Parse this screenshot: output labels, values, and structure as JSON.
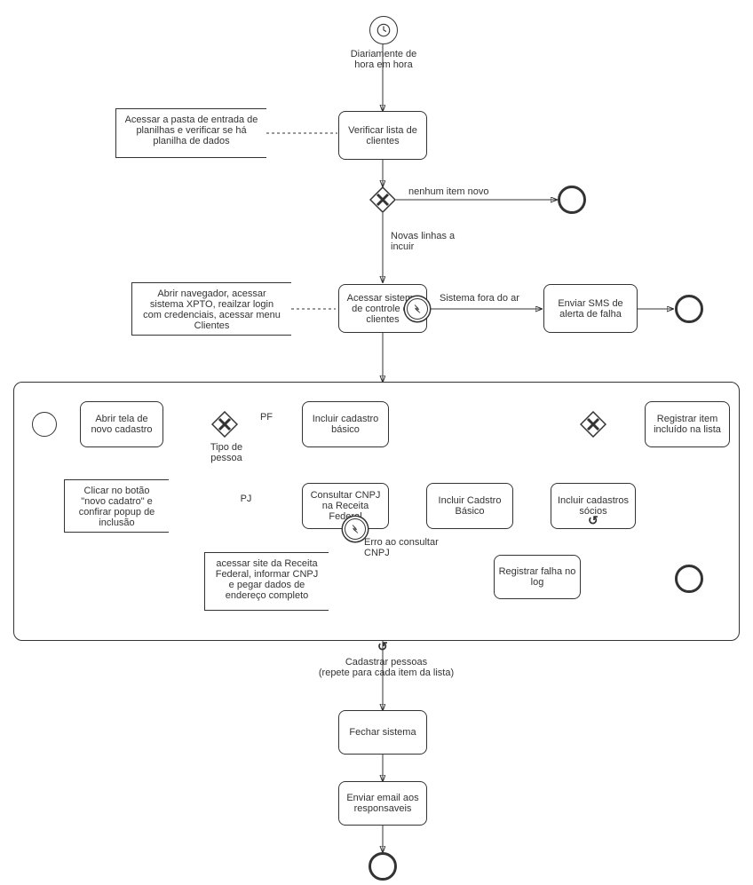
{
  "chart_data": {
    "type": "bpmn-diagram",
    "start_event": {
      "type": "timer",
      "label": "Diariamente de hora em hora"
    },
    "nodes": [
      {
        "id": "verificar",
        "type": "task",
        "label": "Verificar lista de clientes"
      },
      {
        "id": "gw1",
        "type": "exclusive-gateway"
      },
      {
        "id": "acessar",
        "type": "task",
        "label": "Acessar sistema de controle de clientes",
        "boundary": "error"
      },
      {
        "id": "sms",
        "type": "task",
        "label": "Enviar SMS de alerta de falha"
      },
      {
        "id": "subprocess",
        "type": "expanded-subprocess",
        "loop": true,
        "label": "Cadastrar pessoas (repete para cada item da lista)"
      },
      {
        "id": "fechar",
        "type": "task",
        "label": "Fechar sistema"
      },
      {
        "id": "email",
        "type": "task",
        "label": "Enviar email aos responsaveis"
      }
    ],
    "subprocess_nodes": [
      {
        "id": "sp-start",
        "type": "start-event"
      },
      {
        "id": "abrir",
        "type": "task",
        "label": "Abrir tela de novo cadastro"
      },
      {
        "id": "gw-tipo",
        "type": "exclusive-gateway",
        "label": "Tipo de pessoa"
      },
      {
        "id": "incluir-pf",
        "type": "task",
        "label": "Incluir cadastro básico"
      },
      {
        "id": "consultar",
        "type": "task",
        "label": "Consultar CNPJ na Receita Federal",
        "boundary": "error"
      },
      {
        "id": "incluir-pj",
        "type": "task",
        "label": "Incluir Cadstro Básico"
      },
      {
        "id": "socios",
        "type": "task",
        "label": "Incluir cadastros sócios",
        "loop": true
      },
      {
        "id": "gw-merge",
        "type": "exclusive-gateway"
      },
      {
        "id": "registrar",
        "type": "task",
        "label": "Registrar item incluído na lista"
      },
      {
        "id": "falha",
        "type": "task",
        "label": "Registrar falha no log"
      },
      {
        "id": "sp-end",
        "type": "end-event"
      }
    ],
    "edges": [
      {
        "from": "gw1",
        "to": "end1",
        "label": "nenhum item novo"
      },
      {
        "from": "gw1",
        "to": "acessar",
        "label": "Novas linhas a incuir"
      },
      {
        "from": "acessar-boundary",
        "to": "sms",
        "label": "Sistema fora do ar"
      },
      {
        "from": "gw-tipo",
        "to": "incluir-pf",
        "label": "PF"
      },
      {
        "from": "gw-tipo",
        "to": "consultar",
        "label": "PJ"
      },
      {
        "from": "consultar-boundary",
        "to": "falha",
        "label": "Erro ao consultar CNPJ"
      }
    ],
    "annotations": [
      {
        "target": "verificar",
        "text": "Acessar a pasta de entrada de planilhas e verificar se há planilha de dados"
      },
      {
        "target": "acessar",
        "text": "Abrir navegador, acessar sistema XPTO, reailzar login com credenciais, acessar menu Clientes"
      },
      {
        "target": "abrir",
        "text": "Clicar no botão \"novo cadatro\" e confirar popup de inclusão"
      },
      {
        "target": "consultar",
        "text": "acessar site da Receita Federal, informar CNPJ e pegar dados de endereço completo"
      }
    ]
  },
  "start_label": "Diariamente de hora em hora",
  "tasks": {
    "verificar": "Verificar lista de clientes",
    "acessar": "Acessar sistema de controle de clientes",
    "sms": "Enviar SMS de alerta de falha",
    "fechar": "Fechar sistema",
    "email": "Enviar email aos responsaveis",
    "abrir": "Abrir tela de novo cadastro",
    "incluir_pf": "Incluir cadastro básico",
    "consultar": "Consultar CNPJ na Receita Federal",
    "incluir_pj": "Incluir Cadstro Básico",
    "socios": "Incluir cadastros sócios",
    "registrar": "Registrar item incluído na lista",
    "falha": "Registrar falha no log"
  },
  "labels": {
    "gw1_end": "nenhum item novo",
    "gw1_down": "Novas linhas a incuir",
    "boundary1": "Sistema fora do ar",
    "gw_tipo": "Tipo de pessoa",
    "pf": "PF",
    "pj": "PJ",
    "erro_cnpj": "Erro ao consultar CNPJ",
    "subprocess": "Cadastrar pessoas\n(repete para cada item da lista)"
  },
  "annotations": {
    "a1": "Acessar a pasta de entrada de planilhas e verificar se há planilha de dados",
    "a2": "Abrir navegador, acessar sistema XPTO, reailzar login com credenciais, acessar menu Clientes",
    "a3": "Clicar no botão \"novo cadatro\" e confirar popup de inclusão",
    "a4": "acessar site da Receita Federal, informar CNPJ e pegar dados de endereço completo"
  }
}
